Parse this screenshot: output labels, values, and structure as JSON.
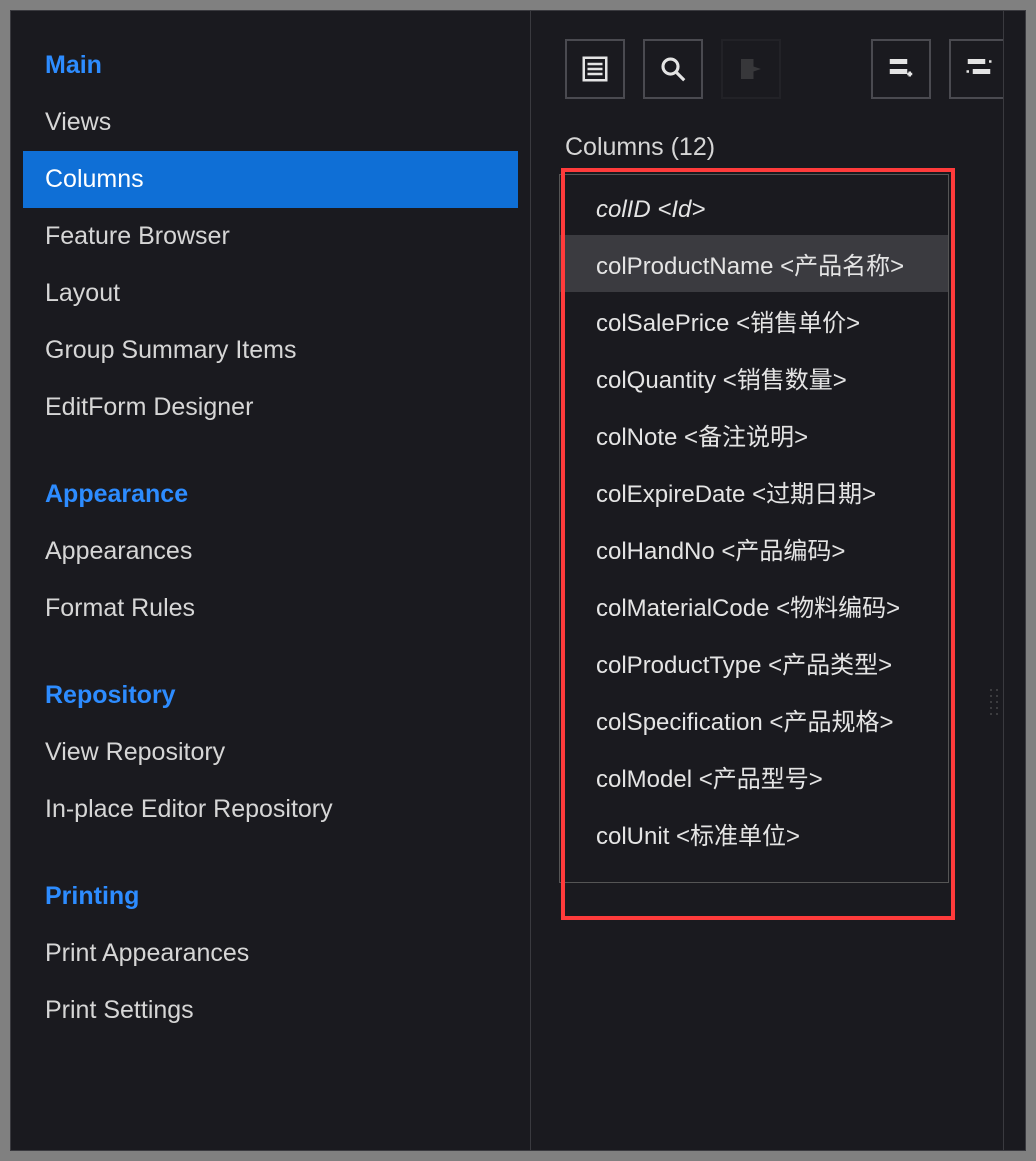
{
  "sidebar": {
    "sections": [
      {
        "title": "Main",
        "items": [
          "Views",
          "Columns",
          "Feature Browser",
          "Layout",
          "Group Summary Items",
          "EditForm Designer"
        ]
      },
      {
        "title": "Appearance",
        "items": [
          "Appearances",
          "Format Rules"
        ]
      },
      {
        "title": "Repository",
        "items": [
          "View Repository",
          "In-place Editor Repository"
        ]
      },
      {
        "title": "Printing",
        "items": [
          "Print Appearances",
          "Print Settings"
        ]
      }
    ],
    "selected": "Columns"
  },
  "columns_panel": {
    "title": "Columns (12)",
    "items": [
      {
        "field": "colID",
        "display": "Id",
        "italic": true
      },
      {
        "field": "colProductName",
        "display": "产品名称",
        "selected": true
      },
      {
        "field": "colSalePrice",
        "display": "销售单价"
      },
      {
        "field": "colQuantity",
        "display": "销售数量"
      },
      {
        "field": "colNote",
        "display": "备注说明"
      },
      {
        "field": "colExpireDate",
        "display": "过期日期"
      },
      {
        "field": "colHandNo",
        "display": "产品编码"
      },
      {
        "field": "colMaterialCode",
        "display": "物料编码"
      },
      {
        "field": "colProductType",
        "display": "产品类型"
      },
      {
        "field": "colSpecification",
        "display": "产品规格"
      },
      {
        "field": "colModel",
        "display": "产品型号"
      },
      {
        "field": "colUnit",
        "display": "标准单位"
      }
    ]
  },
  "toolbar": {
    "btn_list": "list-view",
    "btn_search": "search",
    "btn_export": "export",
    "btn_add": "add-item",
    "btn_adjust": "adjust-item"
  }
}
